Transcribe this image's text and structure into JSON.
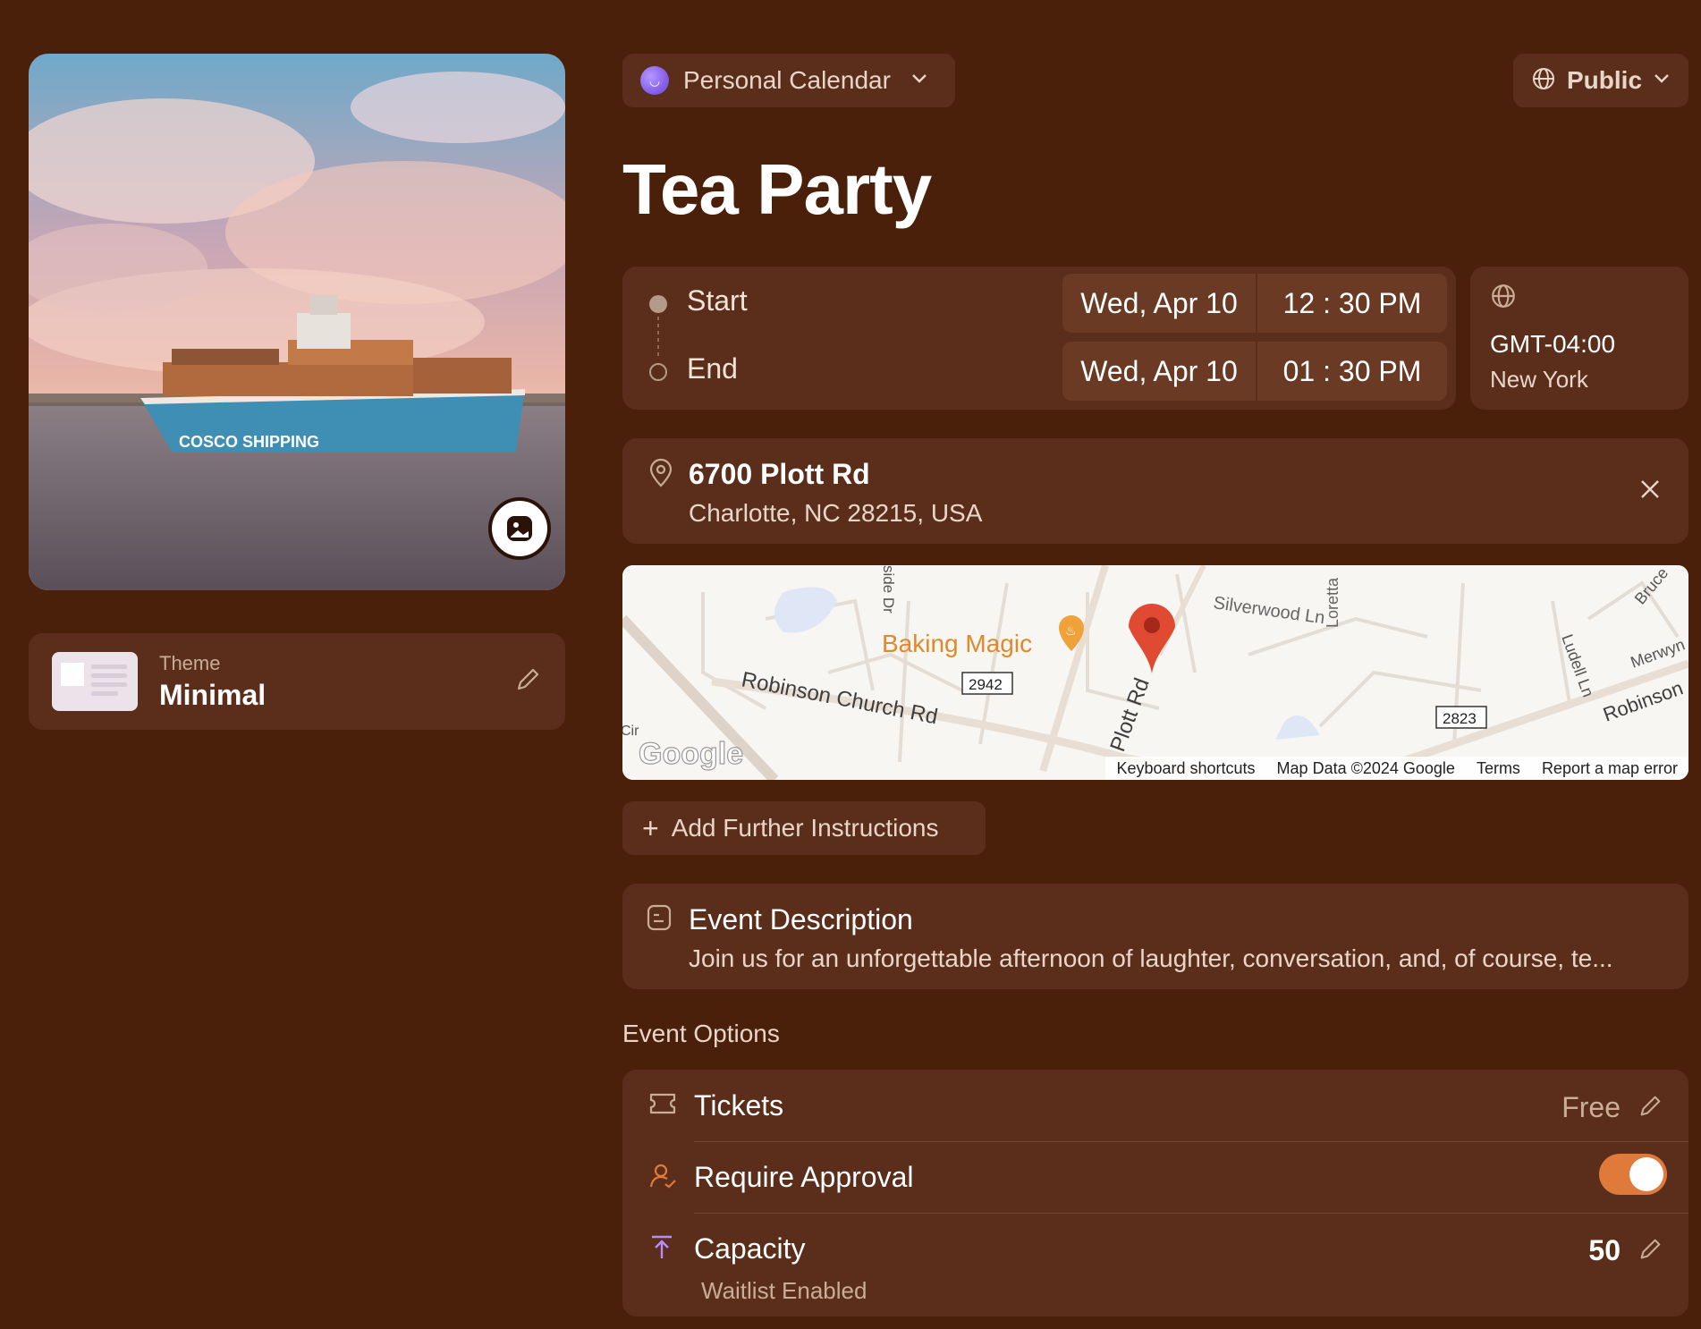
{
  "cover": {
    "image": "container-ship-photo",
    "ship_text": "COSCO SHIPPING"
  },
  "theme": {
    "label": "Theme",
    "name": "Minimal"
  },
  "calendar": {
    "label": "Personal Calendar"
  },
  "visibility": {
    "label": "Public"
  },
  "event": {
    "title": "Tea Party"
  },
  "time": {
    "start_label": "Start",
    "end_label": "End",
    "start_date": "Wed, Apr 10",
    "start_time": "12 : 30  PM",
    "end_date": "Wed, Apr 10",
    "end_time": "01 : 30  PM"
  },
  "timezone": {
    "offset": "GMT-04:00",
    "city": "New York"
  },
  "location": {
    "name": "6700 Plott Rd",
    "address": "Charlotte, NC 28215, USA"
  },
  "map": {
    "place": "Baking Magic",
    "roads": [
      "Robinson Church Rd",
      "Plott Rd",
      "Silverwood Ln",
      "Loretta",
      "Ludell Ln",
      "Merwyn",
      "Robinson",
      "Bruce",
      "side Dr",
      "Cir"
    ],
    "route_badges": [
      "2942",
      "2823"
    ],
    "logo": "Google",
    "footer": [
      "Keyboard shortcuts",
      "Map Data ©2024 Google",
      "Terms",
      "Report a map error"
    ]
  },
  "instructions": {
    "label": "Add Further Instructions"
  },
  "description": {
    "title": "Event Description",
    "text": "Join us for an unforgettable afternoon of laughter, conversation, and, of course, te..."
  },
  "options": {
    "heading": "Event Options",
    "tickets": {
      "label": "Tickets",
      "value": "Free"
    },
    "approval": {
      "label": "Require Approval",
      "enabled": true
    },
    "capacity": {
      "label": "Capacity",
      "value": "50",
      "sub": "Waitlist Enabled"
    }
  },
  "colors": {
    "background": "#4a200b",
    "card": "#5a2e1b",
    "accent_toggle": "#e07a3a",
    "pin": "#e04a32"
  }
}
